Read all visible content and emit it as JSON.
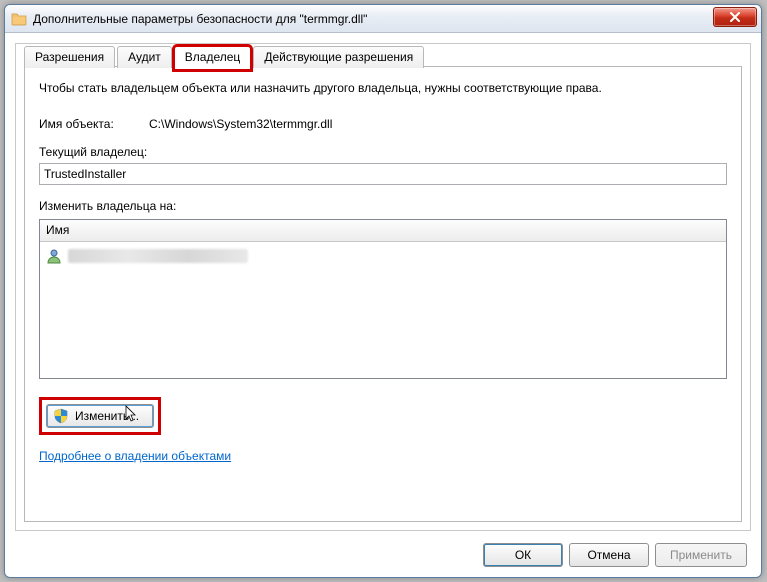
{
  "window": {
    "title": "Дополнительные параметры безопасности  для \"termmgr.dll\""
  },
  "tabs": {
    "permissions": "Разрешения",
    "audit": "Аудит",
    "owner": "Владелец",
    "effective": "Действующие разрешения"
  },
  "panel": {
    "intro": "Чтобы стать владельцем объекта или назначить другого владельца, нужны соответствующие права.",
    "object_name_label": "Имя объекта:",
    "object_name_value": "C:\\Windows\\System32\\termmgr.dll",
    "current_owner_label": "Текущий владелец:",
    "current_owner_value": "TrustedInstaller",
    "change_owner_to_label": "Изменить владельца на:",
    "list_header": "Имя",
    "change_button": "Изменить...",
    "learn_more_link": "Подробнее о владении объектами"
  },
  "buttons": {
    "ok": "ОК",
    "cancel": "Отмена",
    "apply": "Применить"
  }
}
